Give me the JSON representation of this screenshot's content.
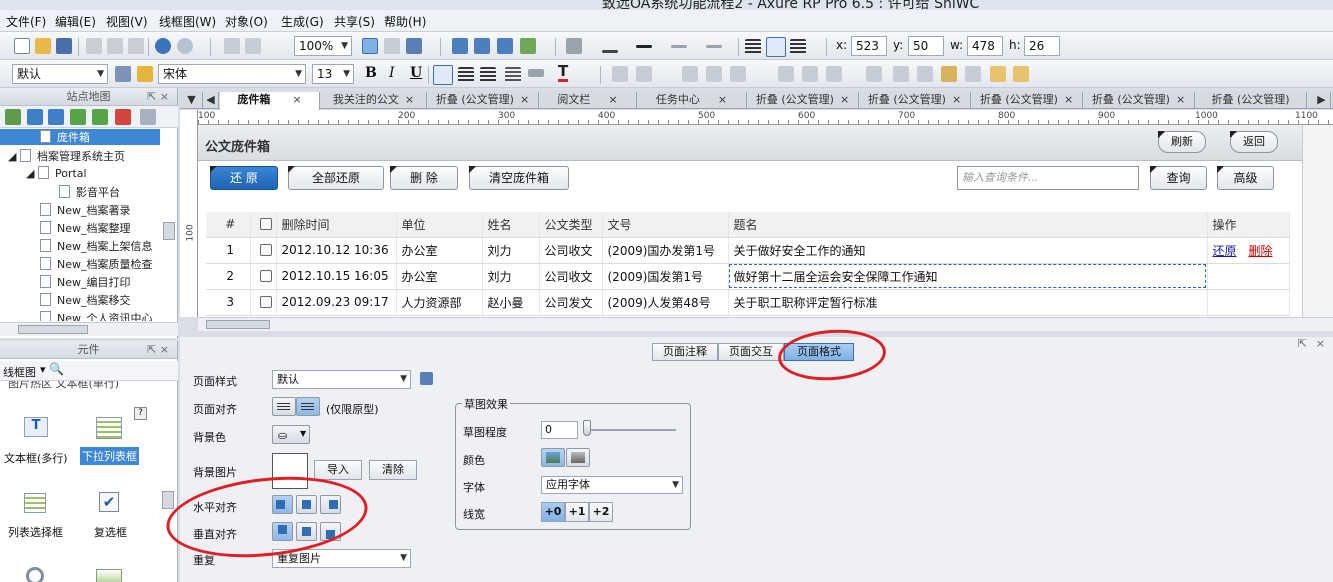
{
  "window": {
    "title": "致远OA系统功能流程2 - Axure RP Pro 6.5 : 许可给 ShiWC"
  },
  "menu": [
    "文件(F)",
    "编辑(E)",
    "视图(V)",
    "线框图(W)",
    "对象(O)",
    "生成(G)",
    "共享(S)",
    "帮助(H)"
  ],
  "toolbar": {
    "zoom": "100%",
    "x_label": "x:",
    "x": "523",
    "y_label": "y:",
    "y": "50",
    "w_label": "w:",
    "w": "478",
    "h_label": "h:",
    "h": "26",
    "style": "默认",
    "font": "宋体",
    "font_size": "13",
    "bold": "B",
    "italic": "I",
    "underline": "U",
    "font_color": "T"
  },
  "sitemap": {
    "title": "站点地图",
    "items": [
      "庞件箱",
      "档案管理系统主页",
      "Portal",
      "影音平台",
      "New_档案著录",
      "New_档案整理",
      "New_档案上架信息",
      "New_档案质量检查",
      "New_编目打印",
      "New_档案移交",
      "New_个人资讯中心"
    ]
  },
  "widgets": {
    "title": "元件",
    "library": "线框图",
    "truncated": "图片热区   文本框(单行)",
    "items": [
      "文本框(多行)",
      "下拉列表框",
      "列表选择框",
      "复选框"
    ],
    "help": "?"
  },
  "tabs": [
    "庞件箱",
    "我关注的公文",
    "折叠 (公文管理)",
    "阅文栏",
    "任务中心",
    "折叠 (公文管理)",
    "折叠 (公文管理)",
    "折叠 (公文管理)",
    "折叠 (公文管理)",
    "折叠 (公文管理)"
  ],
  "ruler": {
    "h": [
      "100",
      "200",
      "300",
      "400",
      "500",
      "600",
      "700",
      "800",
      "900",
      "1000",
      "1100"
    ],
    "v": [
      "100"
    ]
  },
  "page": {
    "title": "公文庞件箱",
    "btn_refresh": "刷新",
    "btn_back": "返回",
    "btn_restore": "还 原",
    "btn_restore_all": "全部还原",
    "btn_delete": "删 除",
    "btn_clear": "清空庞件箱",
    "search_placeholder": "输入查询条件...",
    "btn_query": "查询",
    "btn_advanced": "高级",
    "columns": [
      "#",
      "",
      "删除时间",
      "单位",
      "姓名",
      "公文类型",
      "文号",
      "题名",
      "操作"
    ],
    "rows": [
      {
        "n": "1",
        "time": "2012.10.12 10:36",
        "dept": "办公室",
        "name": "刘力",
        "type": "公司收文",
        "code": "(2009)国办发第1号",
        "title": "关于做好安全工作的通知",
        "op1": "还原",
        "op2": "删除"
      },
      {
        "n": "2",
        "time": "2012.10.15 16:05",
        "dept": "办公室",
        "name": "刘力",
        "type": "公司收文",
        "code": "(2009)国发第1号",
        "title": "做好第十二届全运会安全保障工作通知",
        "op1": "",
        "op2": ""
      },
      {
        "n": "3",
        "time": "2012.09.23 09:17",
        "dept": "人力资源部",
        "name": "赵小曼",
        "type": "公司发文",
        "code": "(2009)人发第48号",
        "title": "关于职工职称评定暂行标准",
        "op1": "",
        "op2": ""
      }
    ]
  },
  "properties": {
    "tabs": [
      "页面注释",
      "页面交互",
      "页面格式"
    ],
    "page_style_label": "页面样式",
    "page_style": "默认",
    "page_align_label": "页面对齐",
    "page_align_note": "(仅限原型)",
    "bg_color_label": "背景色",
    "bg_image_label": "背景图片",
    "import": "导入",
    "clear": "清除",
    "h_align_label": "水平对齐",
    "v_align_label": "垂直对齐",
    "repeat_label": "重复",
    "repeat": "重复图片",
    "sketch_group": "草图效果",
    "sketch_level_label": "草图程度",
    "sketch_level": "0",
    "color_label": "颜色",
    "font_label": "字体",
    "font": "应用字体",
    "line_label": "线宽",
    "line_opts": [
      "+0",
      "+1",
      "+2"
    ]
  },
  "colors": {
    "highlight": "#e01f25",
    "accent": "#1f62b3",
    "link": "#1a1aa6",
    "delete": "#cc0000"
  }
}
